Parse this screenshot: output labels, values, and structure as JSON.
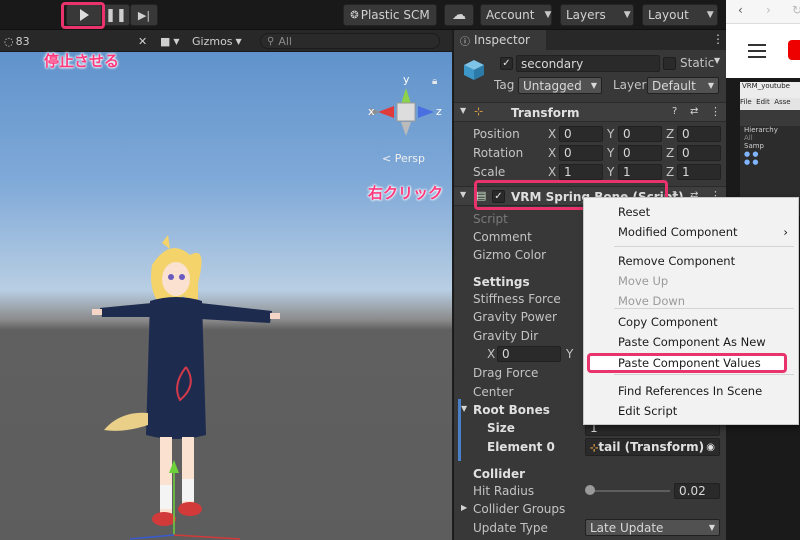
{
  "toolbar": {
    "plastic_scm": "Plastic SCM",
    "account": "Account",
    "layers": "Layers",
    "layout": "Layout"
  },
  "scene": {
    "hidden_count": "83",
    "gizmos": "Gizmos",
    "search_placeholder": "All",
    "axis_y": "y",
    "axis_x": "x",
    "axis_z": "z",
    "persp": "Persp",
    "annotation_stop": "停止させる",
    "annotation_right_click": "右クリック"
  },
  "inspector": {
    "tab": "Inspector",
    "object_name": "secondary",
    "static": "Static",
    "tag_label": "Tag",
    "tag_value": "Untagged",
    "layer_label": "Layer",
    "layer_value": "Default",
    "transform": {
      "title": "Transform",
      "rows": [
        {
          "label": "Position",
          "x": "0",
          "y": "0",
          "z": "0"
        },
        {
          "label": "Rotation",
          "x": "0",
          "y": "0",
          "z": "0"
        },
        {
          "label": "Scale",
          "x": "1",
          "y": "1",
          "z": "1"
        }
      ]
    },
    "spring": {
      "title": "VRM Spring Bone (Script)",
      "script": "Script",
      "comment": "Comment",
      "gizmo_color": "Gizmo Color",
      "settings": "Settings",
      "stiffness": "Stiffness Force",
      "gravity_power": "Gravity Power",
      "gravity_dir": "Gravity Dir",
      "gravity_x": "0",
      "drag": "Drag Force",
      "center": "Center",
      "root_bones": "Root Bones",
      "size_label": "Size",
      "size_value": "1",
      "element0_label": "Element 0",
      "element0_value": "tail (Transform)",
      "collider": "Collider",
      "hit_radius": "Hit Radius",
      "hit_radius_value": "0.02",
      "hit_radius_fraction": 0.02,
      "collider_groups": "Collider Groups",
      "update_type": "Update Type",
      "update_type_value": "Late Update"
    }
  },
  "context_menu": {
    "items": [
      {
        "label": "Reset",
        "enabled": true
      },
      {
        "label": "Modified Component",
        "enabled": true,
        "submenu": true
      },
      {
        "label": "Remove Component",
        "enabled": true
      },
      {
        "label": "Move Up",
        "enabled": false
      },
      {
        "label": "Move Down",
        "enabled": false
      },
      {
        "label": "Copy Component",
        "enabled": true
      },
      {
        "label": "Paste Component As New",
        "enabled": true
      },
      {
        "label": "Paste Component Values",
        "enabled": true,
        "highlighted": true
      },
      {
        "label": "Find References In Scene",
        "enabled": true
      },
      {
        "label": "Edit Script",
        "enabled": true
      }
    ]
  },
  "browser": {
    "title": "VRM_youtube",
    "menu_file": "File",
    "menu_edit": "Edit",
    "menu_assets": "Asse",
    "hierarchy": "Hierarchy",
    "search": "All",
    "sample": "Samp"
  },
  "colors": {
    "annotation": "#e8336d",
    "highlight_bg": "#ffffff"
  }
}
